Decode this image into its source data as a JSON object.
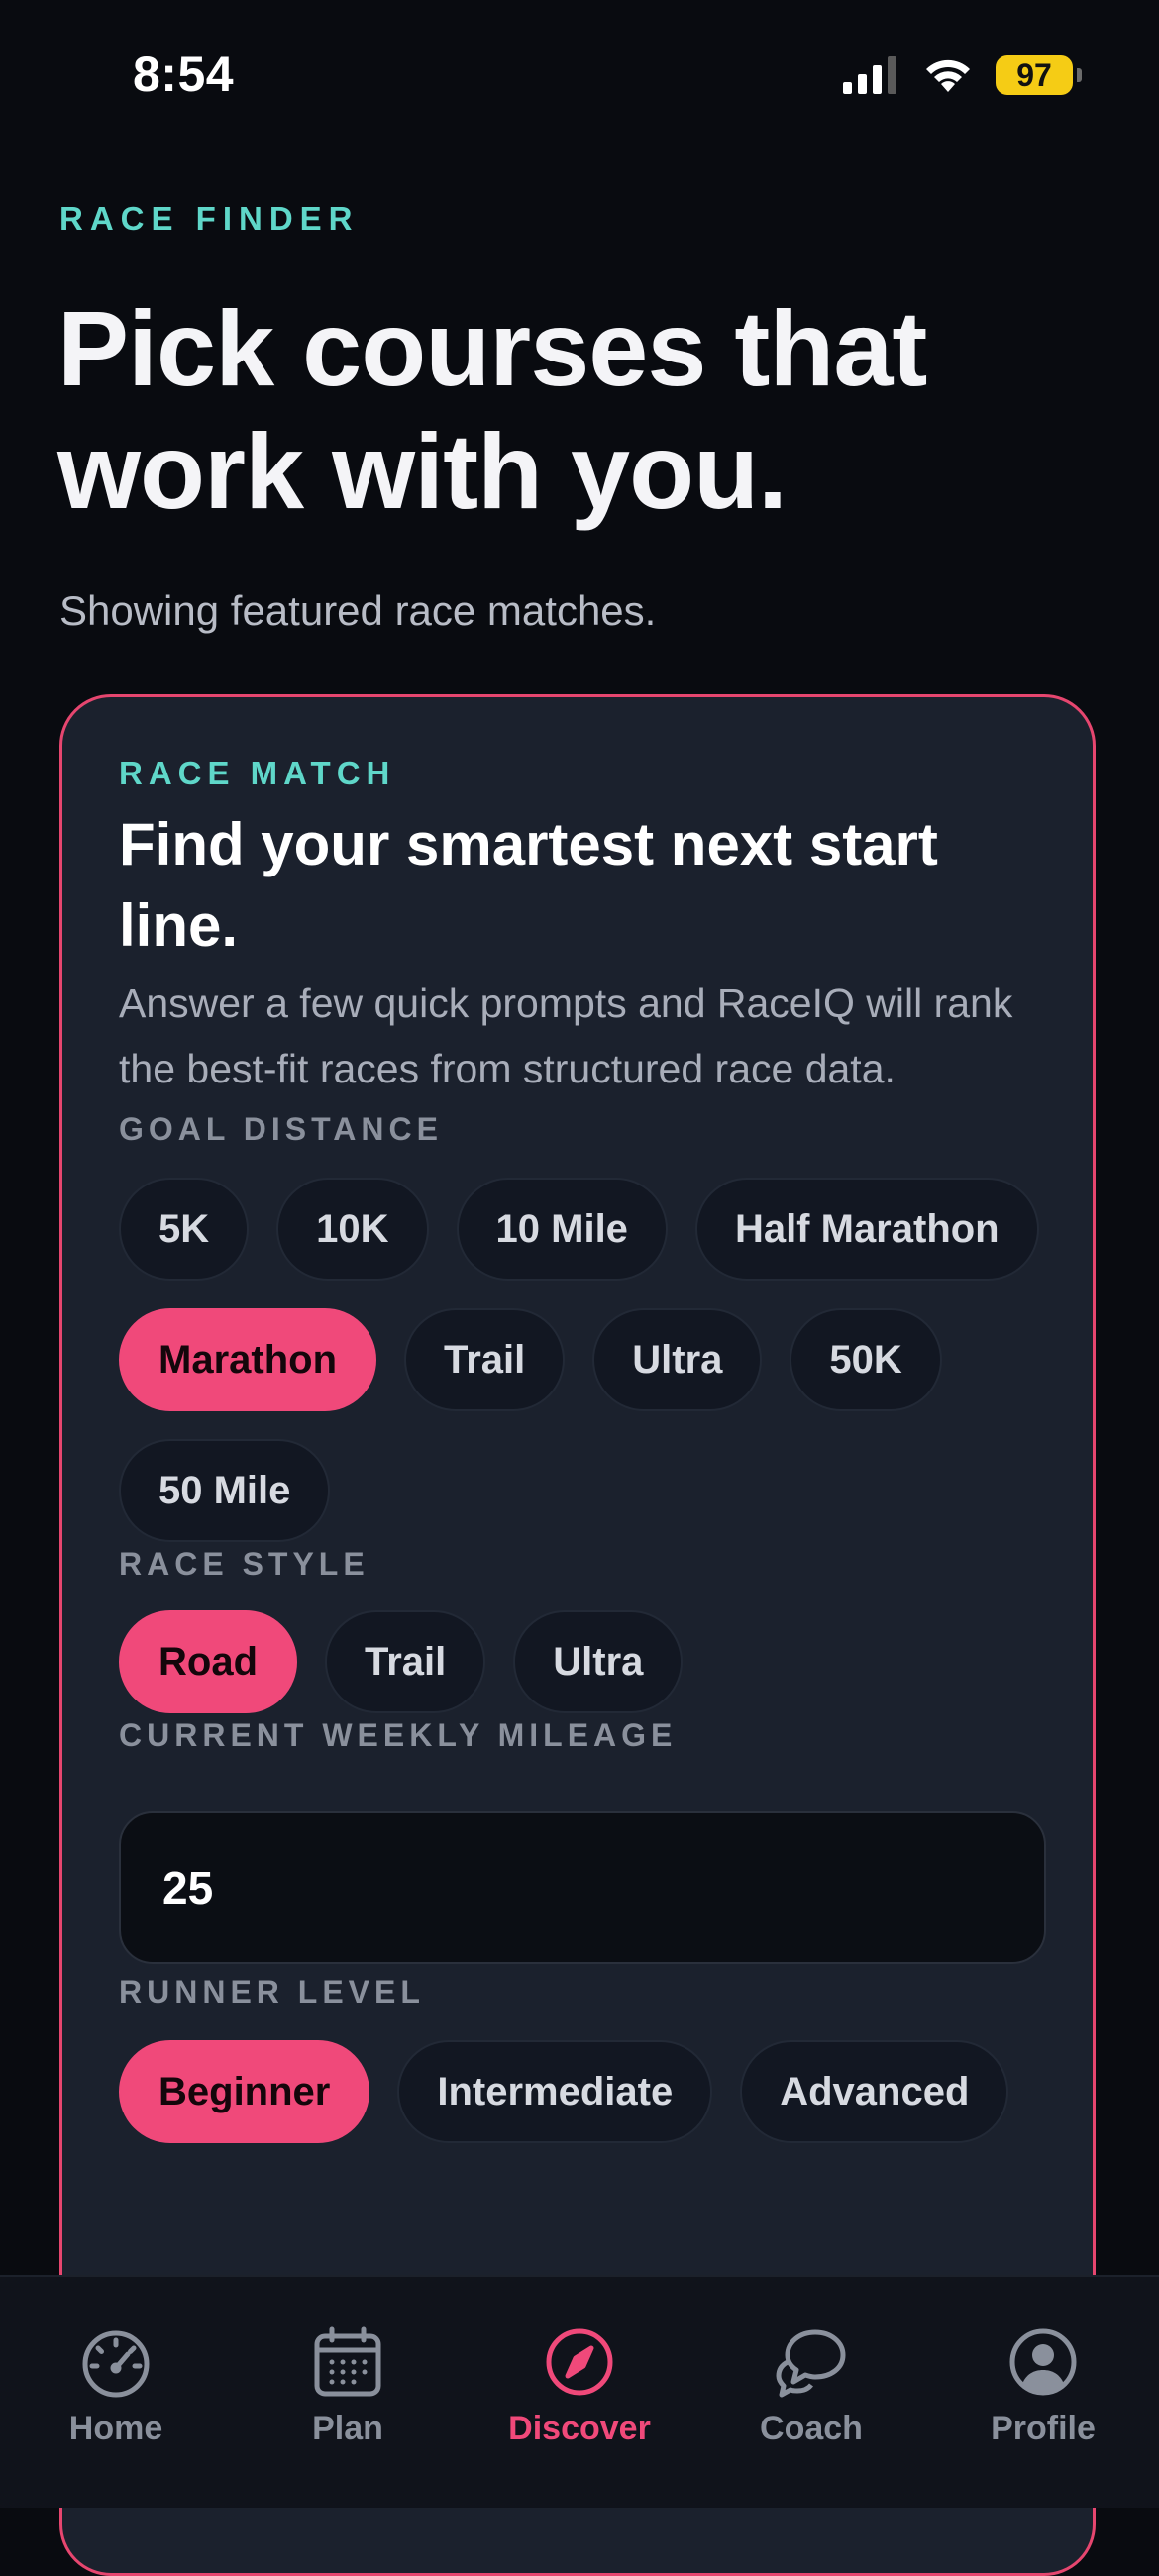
{
  "status_bar": {
    "time": "8:54",
    "battery": "97"
  },
  "header": {
    "eyebrow": "RACE FINDER",
    "title": "Pick courses that work with you.",
    "subtitle": "Showing featured race matches."
  },
  "card": {
    "eyebrow": "RACE MATCH",
    "title": "Find your smartest next start line.",
    "description": "Answer a few quick prompts and RaceIQ will rank the best-fit races from structured race data.",
    "goal_distance": {
      "label": "GOAL DISTANCE",
      "options": [
        "5K",
        "10K",
        "10 Mile",
        "Half Marathon",
        "Marathon",
        "Trail",
        "Ultra",
        "50K",
        "50 Mile"
      ],
      "selected": "Marathon"
    },
    "race_style": {
      "label": "RACE STYLE",
      "options": [
        "Road",
        "Trail",
        "Ultra"
      ],
      "selected": "Road"
    },
    "weekly_mileage": {
      "label": "CURRENT WEEKLY MILEAGE",
      "value": "25"
    },
    "runner_level": {
      "label": "RUNNER LEVEL",
      "options": [
        "Beginner",
        "Intermediate",
        "Advanced"
      ],
      "selected": "Beginner"
    }
  },
  "tab_bar": {
    "tabs": [
      {
        "label": "Home",
        "icon": "gauge-icon"
      },
      {
        "label": "Plan",
        "icon": "calendar-icon"
      },
      {
        "label": "Discover",
        "icon": "compass-icon"
      },
      {
        "label": "Coach",
        "icon": "chat-bubbles-icon"
      },
      {
        "label": "Profile",
        "icon": "user-circle-icon"
      }
    ],
    "active": "Discover"
  },
  "colors": {
    "accent": "#f0497a",
    "teal": "#5fd7c9",
    "background": "#090b10",
    "card": "#1b212d"
  }
}
